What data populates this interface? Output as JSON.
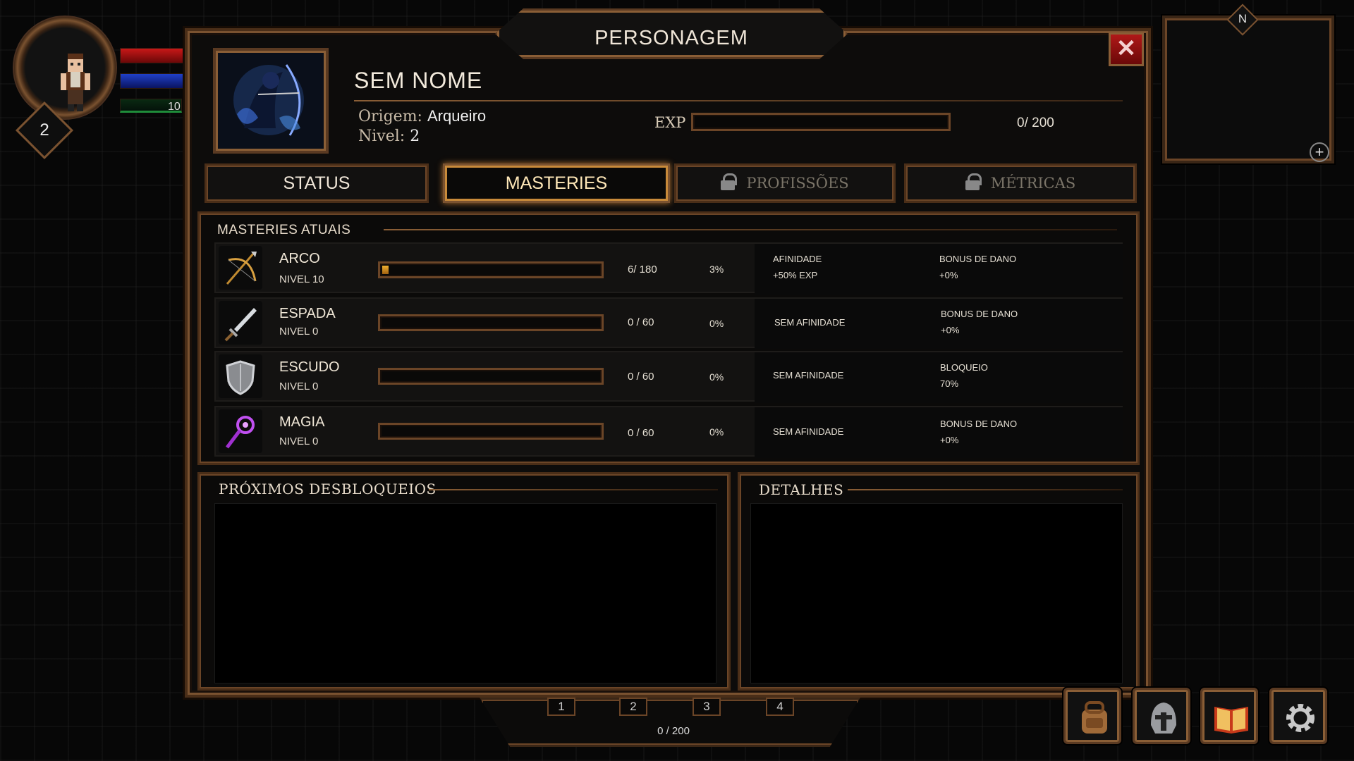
{
  "hud": {
    "level": "2",
    "xp_text": "10"
  },
  "minimap": {
    "compass": "N",
    "zoom_label": "+"
  },
  "window": {
    "title": "PERSONAGEM",
    "close_label": "✕",
    "character": {
      "name": "SEM NOME",
      "origin_label": "Origem:",
      "origin_value": "Arqueiro",
      "level_label": "Nivel:",
      "level_value": "2",
      "exp_label": "EXP",
      "exp_value": "0/ 200",
      "exp_progress": 0
    },
    "tabs": [
      {
        "label": "STATUS",
        "locked": false
      },
      {
        "label": "MASTERIES",
        "locked": false,
        "active": true
      },
      {
        "label": "PROFISSÕES",
        "locked": true
      },
      {
        "label": "MÉTRICAS",
        "locked": true
      }
    ],
    "masteries": {
      "section_title": "MASTERIES ATUAIS",
      "rows": [
        {
          "icon": "bow-icon",
          "name": "ARCO",
          "level": "NIVEL 10",
          "progress": "6/ 180",
          "percent": "3%",
          "fill": 0.03,
          "affinity_1": "AFINIDADE",
          "affinity_2": "+50% EXP",
          "bonus_1": "BONUS DE DANO",
          "bonus_2": "+0%"
        },
        {
          "icon": "sword-icon",
          "name": "ESPADA",
          "level": "NIVEL 0",
          "progress": "0 / 60",
          "percent": "0%",
          "fill": 0,
          "affinity_1": "SEM AFINIDADE",
          "affinity_2": "",
          "bonus_1": "BONUS DE DANO",
          "bonus_2": "+0%"
        },
        {
          "icon": "shield-icon",
          "name": "ESCUDO",
          "level": "NIVEL 0",
          "progress": "0 / 60",
          "percent": "0%",
          "fill": 0,
          "affinity_1": "SEM AFINIDADE",
          "affinity_2": "",
          "bonus_1": "BLOQUEIO",
          "bonus_2": "70%"
        },
        {
          "icon": "magic-staff-icon",
          "name": "MAGIA",
          "level": "NIVEL 0",
          "progress": "0 / 60",
          "percent": "0%",
          "fill": 0,
          "affinity_1": "SEM AFINIDADE",
          "affinity_2": "",
          "bonus_1": "BONUS DE DANO",
          "bonus_2": "+0%"
        }
      ]
    },
    "next_unlocks_title": "PRÓXIMOS DESBLOQUEIOS",
    "details_title": "DETALHES"
  },
  "hotbar": {
    "slots": [
      "1",
      "2",
      "3",
      "4"
    ],
    "value": "0 / 200"
  },
  "menu_buttons": [
    "backpack-icon",
    "helmet-icon",
    "book-icon",
    "gear-icon"
  ],
  "colors": {
    "accent": "#c88a3a",
    "frame": "#6b4527",
    "hp": "#c81818",
    "mp": "#2040c8",
    "xp": "#1f8c3a",
    "close": "#b01818"
  }
}
